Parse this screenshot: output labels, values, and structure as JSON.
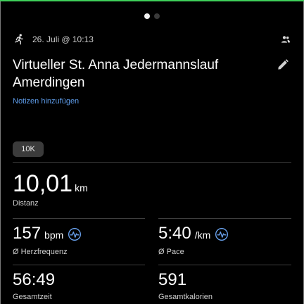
{
  "pager": {
    "page_count": 2,
    "active_index": 0
  },
  "header": {
    "date": "26. Juli @ 10:13",
    "activity_icon": "running-icon",
    "group_icon": "group-icon"
  },
  "activity": {
    "title": "Virtueller St. Anna Jedermannslauf Amerdingen",
    "notes_link": "Notizen hinzufügen",
    "badge": "10K"
  },
  "distance": {
    "value": "10,01",
    "unit": "km",
    "label": "Distanz"
  },
  "heart_rate": {
    "value": "157",
    "unit": "bpm",
    "label": "Ø Herzfrequenz"
  },
  "pace": {
    "value": "5:40",
    "unit": "/km",
    "label": "Ø Pace"
  },
  "duration": {
    "value": "56:49",
    "label": "Gesamtzeit"
  },
  "calories": {
    "value": "591",
    "label": "Gesamtkalorien"
  },
  "colors": {
    "background": "#000000",
    "accent_link": "#5d9be8",
    "chart_icon": "#6aa3f0",
    "top_bar": "#3ecf5a"
  }
}
